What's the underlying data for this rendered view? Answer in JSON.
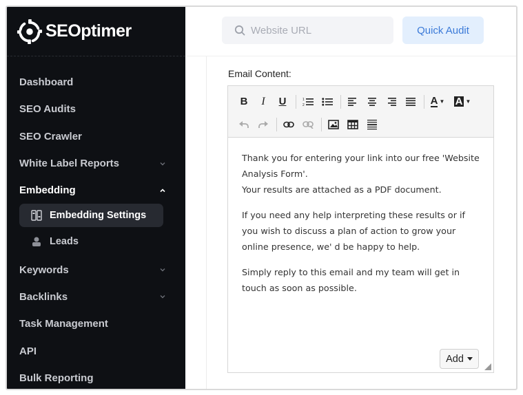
{
  "brand": {
    "name": "SEOptimer"
  },
  "sidebar": {
    "items": [
      {
        "label": "Dashboard",
        "chevron": ""
      },
      {
        "label": "SEO Audits",
        "chevron": ""
      },
      {
        "label": "SEO Crawler",
        "chevron": ""
      },
      {
        "label": "White Label Reports",
        "chevron": "down"
      },
      {
        "label": "Embedding",
        "chevron": "up"
      },
      {
        "label": "Keywords",
        "chevron": "down"
      },
      {
        "label": "Backlinks",
        "chevron": "down"
      },
      {
        "label": "Task Management",
        "chevron": ""
      },
      {
        "label": "API",
        "chevron": ""
      },
      {
        "label": "Bulk Reporting",
        "chevron": ""
      }
    ],
    "subitems": [
      {
        "label": "Embedding Settings",
        "icon": "settings-panel-icon"
      },
      {
        "label": "Leads",
        "icon": "user-icon"
      }
    ]
  },
  "topbar": {
    "search_placeholder": "Website URL",
    "quick_audit_label": "Quick Audit"
  },
  "email": {
    "label": "Email Content:",
    "paragraphs": [
      "Thank you for entering your link into our free 'Website Analysis Form'.",
      "Your results are attached as a PDF document.",
      "If you need any help interpreting these results or if you wish to discuss a plan of action to grow your online presence, we' d be happy to help.",
      "Simply reply to this email and my team will get in touch as soon as possible."
    ],
    "add_label": "Add"
  },
  "toolbar": {
    "bold": "B",
    "italic": "I",
    "underline": "U",
    "text_color_glyph": "A",
    "bg_color_glyph": "A"
  },
  "colors": {
    "sidebar_bg": "#0e1014",
    "accent": "#3b7ad8",
    "accent_bg": "#e3effd"
  }
}
